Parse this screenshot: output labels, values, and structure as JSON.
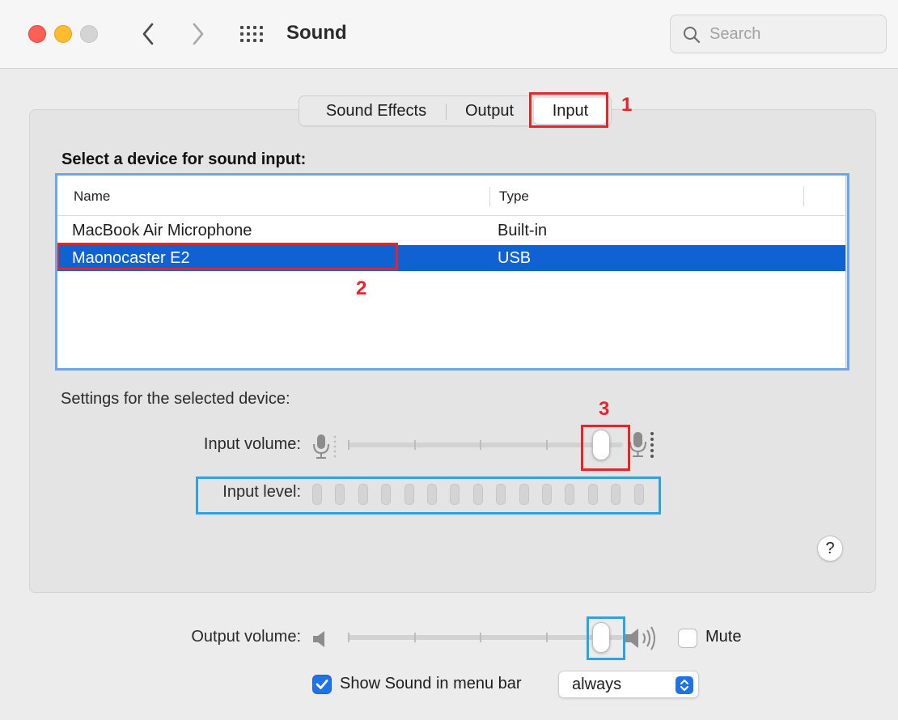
{
  "window": {
    "title": "Sound",
    "search_placeholder": "Search"
  },
  "tabs": [
    {
      "label": "Sound Effects",
      "selected": false
    },
    {
      "label": "Output",
      "selected": false
    },
    {
      "label": "Input",
      "selected": true
    }
  ],
  "device_section": {
    "heading": "Select a device for sound input:",
    "columns": [
      "Name",
      "Type"
    ],
    "rows": [
      {
        "name": "MacBook Air Microphone",
        "type": "Built-in",
        "selected": false
      },
      {
        "name": "Maonocaster E2",
        "type": "USB",
        "selected": true
      }
    ]
  },
  "settings": {
    "label": "Settings for the selected device:",
    "input_volume_label": "Input volume:",
    "input_volume_fraction": 0.92,
    "input_level_label": "Input level:",
    "input_level_bars": 15,
    "input_level_active": 0
  },
  "output": {
    "volume_label": "Output volume:",
    "volume_fraction": 0.92,
    "mute_label": "Mute",
    "mute_checked": false,
    "show_in_menu_bar_label": "Show Sound in menu bar",
    "show_in_menu_bar_checked": true,
    "menu_bar_option": "always"
  },
  "help_label": "?",
  "annotations": {
    "labels": [
      "1",
      "2",
      "3"
    ],
    "colors": {
      "red": "#e3262b",
      "blue": "#2ba3e6"
    }
  },
  "colors": {
    "accent": "#1f73e8",
    "selection": "#1062d3"
  }
}
